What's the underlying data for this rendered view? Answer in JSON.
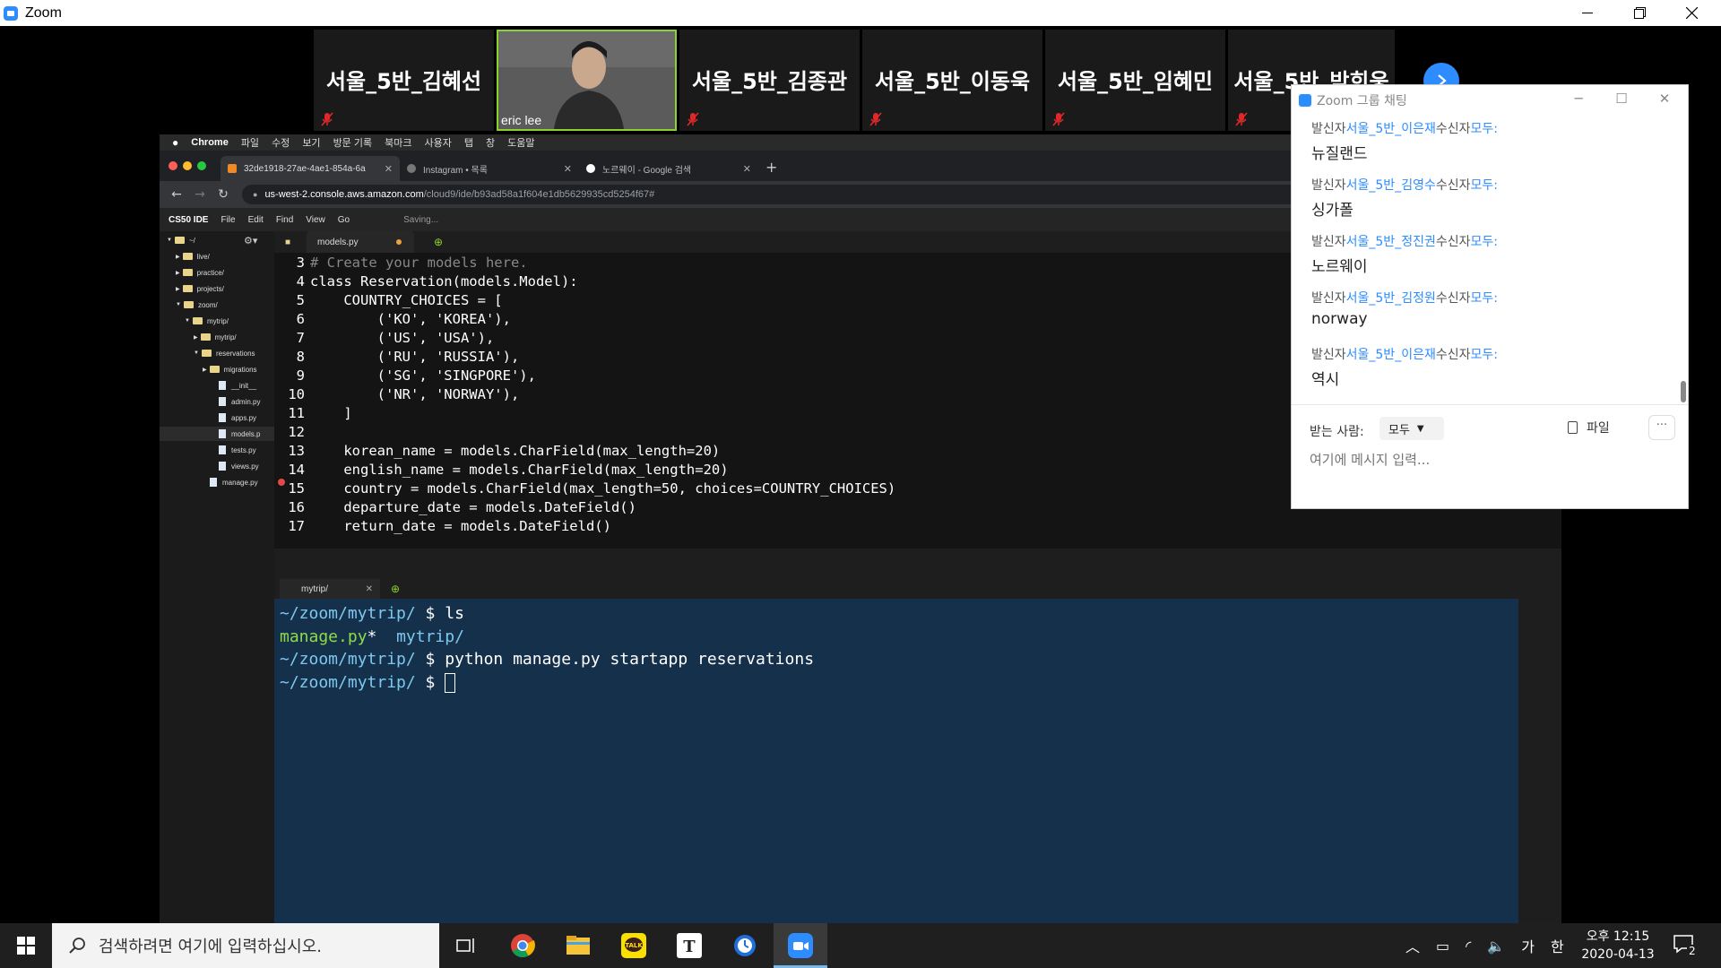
{
  "window": {
    "app_title": "Zoom"
  },
  "participants": [
    {
      "name": "서울_5반_김혜선",
      "muted": true
    },
    {
      "name": "eric lee",
      "video": true
    },
    {
      "name": "서울_5반_김종관",
      "muted": true
    },
    {
      "name": "서울_5반_이동욱",
      "muted": true
    },
    {
      "name": "서울_5반_임혜민",
      "muted": true
    },
    {
      "name": "서울_5반_박희웅",
      "muted": true
    }
  ],
  "mac_menu": [
    "Chrome",
    "파일",
    "수정",
    "보기",
    "방문 기록",
    "북마크",
    "사용자",
    "탭",
    "창",
    "도움말"
  ],
  "browser_tabs": [
    {
      "title": "32de1918-27ae-4ae1-854a-6a",
      "icon_color": "#f08a24"
    },
    {
      "title": "Instagram • 목록",
      "icon_color": "#777777"
    },
    {
      "title": "노르웨이 - Google 검색",
      "icon_color": "#ffffff"
    }
  ],
  "address": {
    "host": "us-west-2.console.aws.amazon.com",
    "path": "/cloud9/ide/b93ad58a1f604e1db5629935cd5254f67#"
  },
  "ide_menu": {
    "brand": "CS50 IDE",
    "items": [
      "File",
      "Edit",
      "Find",
      "View",
      "Go"
    ],
    "status": "Saving..."
  },
  "file_tree": [
    {
      "label": "~/",
      "type": "folder"
    },
    {
      "label": "live/",
      "type": "folder"
    },
    {
      "label": "practice/",
      "type": "folder"
    },
    {
      "label": "projects/",
      "type": "folder"
    },
    {
      "label": "zoom/",
      "type": "folder"
    },
    {
      "label": "mytrip/",
      "type": "folder"
    },
    {
      "label": "mytrip/",
      "type": "folder"
    },
    {
      "label": "reservations",
      "type": "folder"
    },
    {
      "label": "migrations",
      "type": "folder"
    },
    {
      "label": "__init__",
      "type": "file"
    },
    {
      "label": "admin.py",
      "type": "file"
    },
    {
      "label": "apps.py",
      "type": "file"
    },
    {
      "label": "models.p",
      "type": "file"
    },
    {
      "label": "tests.py",
      "type": "file"
    },
    {
      "label": "views.py",
      "type": "file"
    },
    {
      "label": "manage.py",
      "type": "file"
    }
  ],
  "editor": {
    "tab_title": "models.py",
    "lines": [
      {
        "n": "3",
        "text": "# Create your models here."
      },
      {
        "n": "4",
        "text": "class Reservation(models.Model):"
      },
      {
        "n": "5",
        "text": "    COUNTRY_CHOICES = ["
      },
      {
        "n": "6",
        "text": "        ('KO', 'KOREA'),"
      },
      {
        "n": "7",
        "text": "        ('US', 'USA'),"
      },
      {
        "n": "8",
        "text": "        ('RU', 'RUSSIA'),"
      },
      {
        "n": "9",
        "text": "        ('SG', 'SINGPORE'),"
      },
      {
        "n": "10",
        "text": "        ('NR', 'NORWAY'),"
      },
      {
        "n": "11",
        "text": "    ]"
      },
      {
        "n": "12",
        "text": ""
      },
      {
        "n": "13",
        "text": "    korean_name = models.CharField(max_length=20)"
      },
      {
        "n": "14",
        "text": "    english_name = models.CharField(max_length=20)"
      },
      {
        "n": "15",
        "text": "    country = models.CharField(max_length=50, choices=COUNTRY_CHOICES)"
      },
      {
        "n": "16",
        "text": "    departure_date = models.DateField()"
      },
      {
        "n": "17",
        "text": "    return_date = models.DateField()"
      }
    ]
  },
  "terminal": {
    "tab_title": "mytrip/",
    "lines": [
      {
        "prompt": "~/zoom/mytrip/",
        "cmd": " $ ls"
      },
      {
        "out_green": "manage.py",
        "out_rest": "*  ",
        "out_blue": "mytrip/"
      },
      {
        "prompt": "~/zoom/mytrip/",
        "cmd": " $ python manage.py startapp reservations"
      },
      {
        "prompt": "~/zoom/mytrip/",
        "cmd": " $ "
      }
    ]
  },
  "chat": {
    "title": "Zoom 그룹 채팅",
    "messages": [
      {
        "from_label": "발신자",
        "sender": "서울_5반_이은재",
        "to_label": "수신자",
        "recipient": "모두:",
        "text": "뉴질랜드"
      },
      {
        "from_label": "발신자",
        "sender": "서울_5반_김영수",
        "to_label": "수신자",
        "recipient": "모두:",
        "text": "싱가폴"
      },
      {
        "from_label": "발신자",
        "sender": "서울_5반_정진권",
        "to_label": "수신자",
        "recipient": "모두:",
        "text": "노르웨이"
      },
      {
        "from_label": "발신자",
        "sender": "서울_5반_김정원",
        "to_label": "수신자",
        "recipient": "모두:",
        "text": "norway"
      },
      {
        "from_label": "발신자",
        "sender": "서울_5반_이은재",
        "to_label": "수신자",
        "recipient": "모두:",
        "text": "역시"
      }
    ],
    "to_label": "받는 사람:",
    "to_value": "모두",
    "file_label": "파일",
    "more_label": "···",
    "input_placeholder": "여기에 메시지 입력..."
  },
  "taskbar": {
    "search_placeholder": "검색하려면 여기에 입력하십시오.",
    "ime_label": "가",
    "ime_mode": "한",
    "time": "오후 12:15",
    "date": "2020-04-13",
    "notification_count": "2"
  },
  "colors": {
    "zoom_blue": "#2d8cff",
    "active_speaker": "#8bd22c",
    "terminal_bg": "#15304a"
  }
}
